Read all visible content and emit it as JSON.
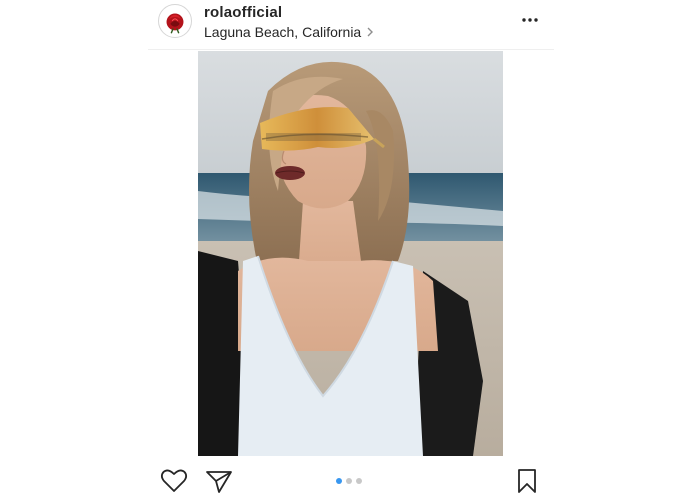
{
  "post": {
    "username": "rolaofficial",
    "location": "Laguna Beach, California",
    "avatar_icon": "rose-icon",
    "more_icon": "more-options-icon"
  },
  "carousel": {
    "total": 3,
    "active_index": 0
  },
  "actions": {
    "like_icon": "heart-icon",
    "share_icon": "paper-plane-icon",
    "save_icon": "bookmark-icon"
  },
  "colors": {
    "text": "#262626",
    "accent_dot": "#3897f0",
    "inactive_dot": "#c8c8c8",
    "divider": "#efefef"
  }
}
